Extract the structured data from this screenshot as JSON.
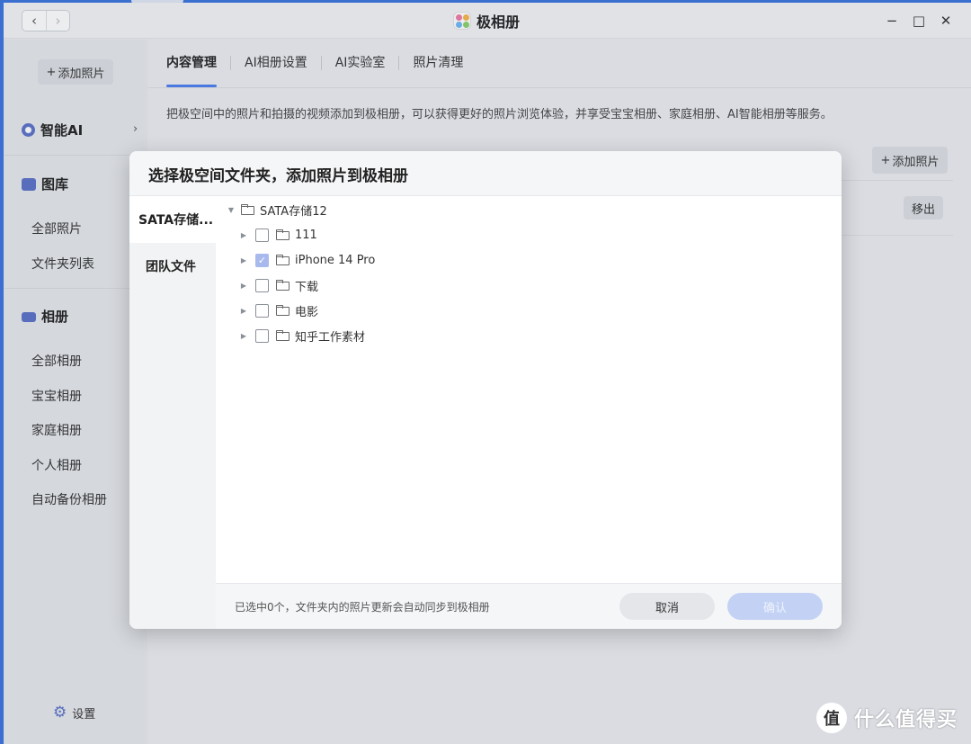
{
  "window": {
    "title": "极相册",
    "back_glyph": "‹",
    "forward_glyph": "›",
    "controls": {
      "minimize": "−",
      "maximize": "□",
      "close": "✕"
    }
  },
  "sidebar": {
    "add_photo_label": "添加照片",
    "add_icon": "+",
    "sections": [
      {
        "label": "智能AI",
        "icon": "ai-icon",
        "has_chevron": true,
        "chevron": "›"
      },
      {
        "label": "图库",
        "icon": "gallery-icon"
      },
      {
        "label": "相册",
        "icon": "album-icon"
      }
    ],
    "gallery_items": [
      "全部照片",
      "文件夹列表"
    ],
    "album_items": [
      "全部相册",
      "宝宝相册",
      "家庭相册",
      "个人相册",
      "自动备份相册"
    ],
    "settings_label": "设置",
    "settings_icon": "⚙"
  },
  "main": {
    "tabs": [
      "内容管理",
      "AI相册设置",
      "AI实验室",
      "照片清理"
    ],
    "active_tab": 0,
    "description": "把极空间中的照片和拍摄的视频添加到极相册，可以获得更好的照片浏览体验，并享受宝宝相册、家庭相册、AI智能相册等服务。",
    "add_photo_label": "添加照片",
    "remove_label": "移出"
  },
  "dialog": {
    "title": "选择极空间文件夹，添加照片到极相册",
    "sources": [
      "SATA存储...",
      "团队文件"
    ],
    "active_source": 0,
    "root": {
      "label": "SATA存储12",
      "arrow": "▼"
    },
    "folders": [
      {
        "label": "111",
        "checked": false
      },
      {
        "label": "iPhone 14 Pro",
        "checked": true
      },
      {
        "label": "下载",
        "checked": false
      },
      {
        "label": "电影",
        "checked": false
      },
      {
        "label": "知乎工作素材",
        "checked": false
      }
    ],
    "collapsed_arrow": "▶",
    "check_glyph": "✓",
    "footer_text": "已选中0个，文件夹内的照片更新会自动同步到极相册",
    "cancel_label": "取消",
    "confirm_label": "确认"
  },
  "watermark": {
    "circle_text": "值",
    "text": "什么值得买"
  },
  "colors": {
    "accent": "#4a7ef0",
    "checked": "#a8b9ee",
    "confirm_disabled": "#c3d2f4"
  }
}
